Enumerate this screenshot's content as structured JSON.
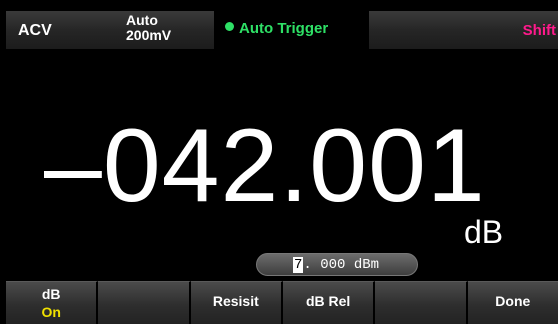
{
  "status_bar": {
    "function": "ACV",
    "range_mode": "Auto",
    "range_value": "200mV",
    "trigger": "Auto Trigger",
    "shift": "Shift"
  },
  "reading": {
    "value": "–042.001",
    "unit": "dB"
  },
  "reference": {
    "cursor_digit": "7",
    "rest": ". 000 dBm"
  },
  "softkeys": [
    {
      "label": "dB",
      "state": "On"
    },
    {
      "label": ""
    },
    {
      "label": "Resisit"
    },
    {
      "label": "dB Rel"
    },
    {
      "label": ""
    },
    {
      "label": "Done"
    }
  ],
  "colors": {
    "trigger_green": "#2ee066",
    "shift_pink": "#ff1a8c",
    "state_yellow": "#f0e000"
  }
}
